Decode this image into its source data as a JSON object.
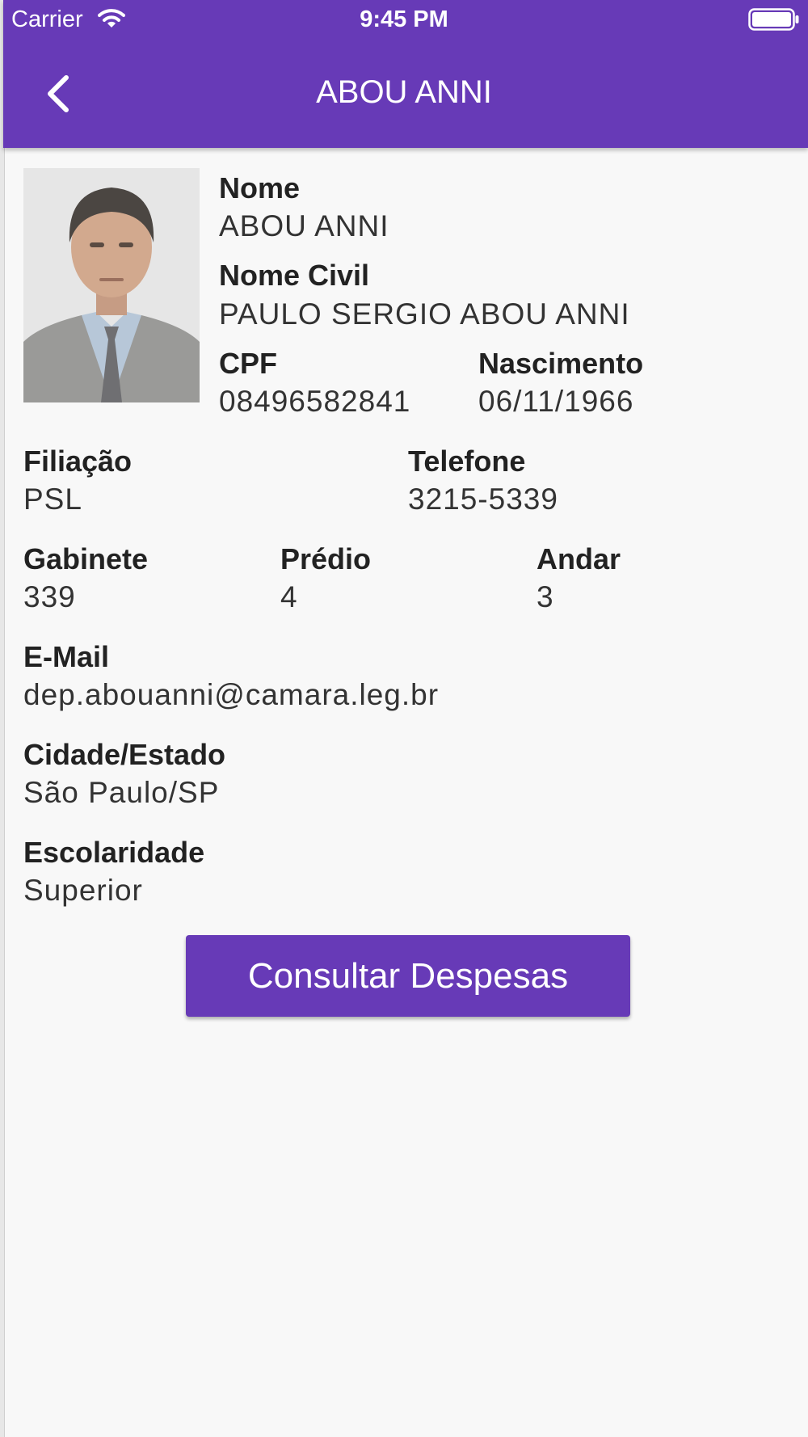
{
  "status_bar": {
    "carrier": "Carrier",
    "time": "9:45 PM"
  },
  "header": {
    "title": "ABOU ANNI",
    "back_icon": "chevron-left-icon"
  },
  "profile": {
    "nome": {
      "label": "Nome",
      "value": "ABOU ANNI"
    },
    "nome_civil": {
      "label": "Nome Civil",
      "value": "PAULO SERGIO ABOU ANNI"
    },
    "cpf": {
      "label": "CPF",
      "value": "08496582841"
    },
    "nascimento": {
      "label": "Nascimento",
      "value": "06/11/1966"
    },
    "filiacao": {
      "label": "Filiação",
      "value": "PSL"
    },
    "telefone": {
      "label": "Telefone",
      "value": "3215-5339"
    },
    "gabinete": {
      "label": "Gabinete",
      "value": "339"
    },
    "predio": {
      "label": "Prédio",
      "value": "4"
    },
    "andar": {
      "label": "Andar",
      "value": "3"
    },
    "email": {
      "label": "E-Mail",
      "value": "dep.abouanni@camara.leg.br"
    },
    "cidade_estado": {
      "label": "Cidade/Estado",
      "value": "São Paulo/SP"
    },
    "escolaridade": {
      "label": "Escolaridade",
      "value": "Superior"
    }
  },
  "actions": {
    "consultar_label": "Consultar Despesas"
  },
  "colors": {
    "primary": "#673ab7",
    "background": "#f8f8f8",
    "on_primary": "#ffffff"
  }
}
